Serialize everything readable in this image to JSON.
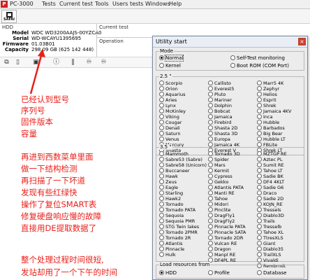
{
  "titlebar": {
    "app_title": "PC-3000",
    "menu": [
      "Tests",
      "Current test",
      "Tools",
      "Users tests",
      "Windows",
      "Help"
    ]
  },
  "logo": {
    "text": "SAFAI"
  },
  "info": {
    "hdd_label": "HDD",
    "fields": [
      {
        "key": "Model",
        "value": "WDC WD3200AAJS-00YZCA0"
      },
      {
        "key": "Serial",
        "value": "WD-WCAYU1395695"
      },
      {
        "key": "Firmware",
        "value": "01.03B01"
      },
      {
        "key": "Capacity",
        "value": "298.09 GB (625 142 448)"
      }
    ],
    "current_test_label": "Current test",
    "operation_label": "Operation"
  },
  "toolbar2_icons": [
    "copy-icon",
    "page-icon",
    "save-icon",
    "info-icon",
    "pause-icon",
    "binoculars-icon",
    "binoculars-alt-icon"
  ],
  "annotations": [
    "已经认到型号",
    "序列号",
    "固件版本",
    "容量",
    "再进到西数菜单里面",
    "做一下结构检测",
    "再扫描了一下坏道",
    "发现有些红绿快",
    "操作了复位SMART表",
    "修复硬盘响应慢的故障",
    "直接用DE提取数据了",
    "整个处理过程时间很短,",
    "发站却用了一个下午的时间"
  ],
  "dialog": {
    "title": "Utility start",
    "close_label": "×",
    "mode": {
      "label": "Mode",
      "options": [
        {
          "label": "Normal",
          "selected": true
        },
        {
          "label": "Self-Test monitoring",
          "selected": false
        },
        {
          "label": "Kernel",
          "selected": false
        },
        {
          "label": "Boot ROM (COM Port)",
          "selected": false
        }
      ]
    },
    "group25": {
      "label": "2.5 \"",
      "columns": [
        [
          "Scorpio",
          "Orion",
          "Aquarius",
          "Aries",
          "Lynx",
          "McKinley",
          "Viking",
          "Cougar",
          "Denali",
          "Saturn",
          "Venus",
          "Mercury",
          "Shasta"
        ],
        [
          "Callisto",
          "Everest5",
          "Pluto",
          "Mariner",
          "Dolphin",
          "Bobcat",
          "Jamaica",
          "Firebird",
          "Shasta 2D",
          "Shasta 3D",
          "Europa",
          "Jamaica 4K",
          "Everest V"
        ],
        [
          "Marr5 4K",
          "Zephyr",
          "Helios",
          "Esprit",
          "Shrek",
          "Jamaica 4KV",
          "Inca",
          "Hubble",
          "Barbados",
          "Big Bear",
          "Hubble LT",
          "FBLite",
          "Shrek LT"
        ]
      ]
    },
    "group35": {
      "label": "3.5 \"",
      "columns": [
        [
          "Mammoth",
          "Sabre53 (Sabre)",
          "Sabre58 (Unicorn)",
          "Buccaneer",
          "Hawk",
          "Zeus",
          "Eagle",
          "Starling",
          "Hawk2",
          "Tornado",
          "Tornado PATA",
          "Sequoia",
          "Sequoia PMR",
          "STG Twin lakes",
          "Tornado 2PMR",
          "Tornado 2R",
          "Atlantis",
          "Pinnacle",
          "Hulk"
        ],
        [
          "Tornado 3D",
          "Spider",
          "Mars",
          "Kermit",
          "Cypress",
          "Gekko",
          "Atlantis PATA",
          "Manti RE",
          "Tahoe",
          "Midori",
          "Pinclite",
          "DragFly1",
          "DragFly2",
          "Pinnacle PATA",
          "Pinnacle SATA",
          "Tornado 2DR",
          "Vulcan RE",
          "Dragon",
          "Manpl RE",
          "DF4PL RE"
        ],
        [
          "MZTGP RE",
          "Aztec PL",
          "Sumit RE",
          "Tahoe LT",
          "Sadie BK",
          "DF4 4KLT",
          "Sadie G6",
          "Draco",
          "Sadie 2D",
          "KOJN_RE",
          "Tressels",
          "Diablo3D",
          "Trails",
          "Tresselb",
          "Tahoe XL",
          "TtresXLS",
          "Giant",
          "Diablo35",
          "TrailXLS",
          "Vivaldi",
          "Rembrndt"
        ]
      ]
    },
    "load": {
      "label": "Load resources from",
      "options": [
        {
          "label": "HDD",
          "selected": true
        },
        {
          "label": "Profile",
          "selected": false
        },
        {
          "label": "Database",
          "selected": false
        }
      ]
    }
  }
}
